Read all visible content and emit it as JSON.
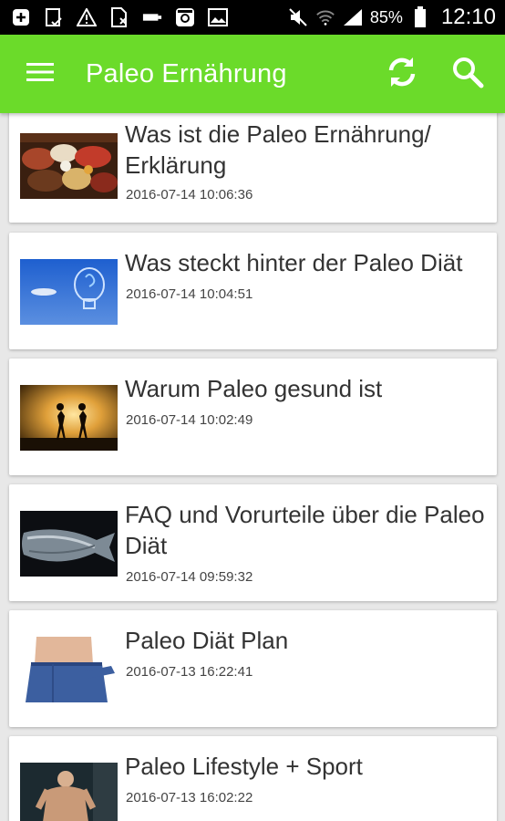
{
  "status_bar": {
    "icons": [
      "add-icon",
      "clipboard-check-icon",
      "warning-icon",
      "sim-error-icon",
      "usb-icon",
      "instagram-icon",
      "image-icon"
    ],
    "right_icons": [
      "mute-icon",
      "wifi-icon",
      "signal-icon",
      "battery-icon"
    ],
    "battery": "85%",
    "time": "12:10"
  },
  "app_bar": {
    "title": "Paleo Ernährung",
    "menu_icon": "menu-icon",
    "refresh_icon": "refresh-icon",
    "search_icon": "search-icon",
    "color": "#6bdb2a"
  },
  "articles": [
    {
      "title": "Was ist die Paleo Ernährung/ Erklärung",
      "date": "2016-07-14 10:06:36",
      "thumb": "food-image"
    },
    {
      "title": "Was steckt hinter der Paleo Diät",
      "date": "2016-07-14 10:04:51",
      "thumb": "lightbulb-sky-image"
    },
    {
      "title": "Warum Paleo gesund ist",
      "date": "2016-07-14 10:02:49",
      "thumb": "runners-sunset-image"
    },
    {
      "title": "FAQ und Vorurteile über die Paleo Diät",
      "date": "2016-07-14 09:59:32",
      "thumb": "fish-image"
    },
    {
      "title": "Paleo Diät Plan",
      "date": "2016-07-13 16:22:41",
      "thumb": "weightloss-jeans-image"
    },
    {
      "title": "Paleo Lifestyle + Sport",
      "date": "2016-07-13 16:02:22",
      "thumb": "athlete-image"
    }
  ]
}
